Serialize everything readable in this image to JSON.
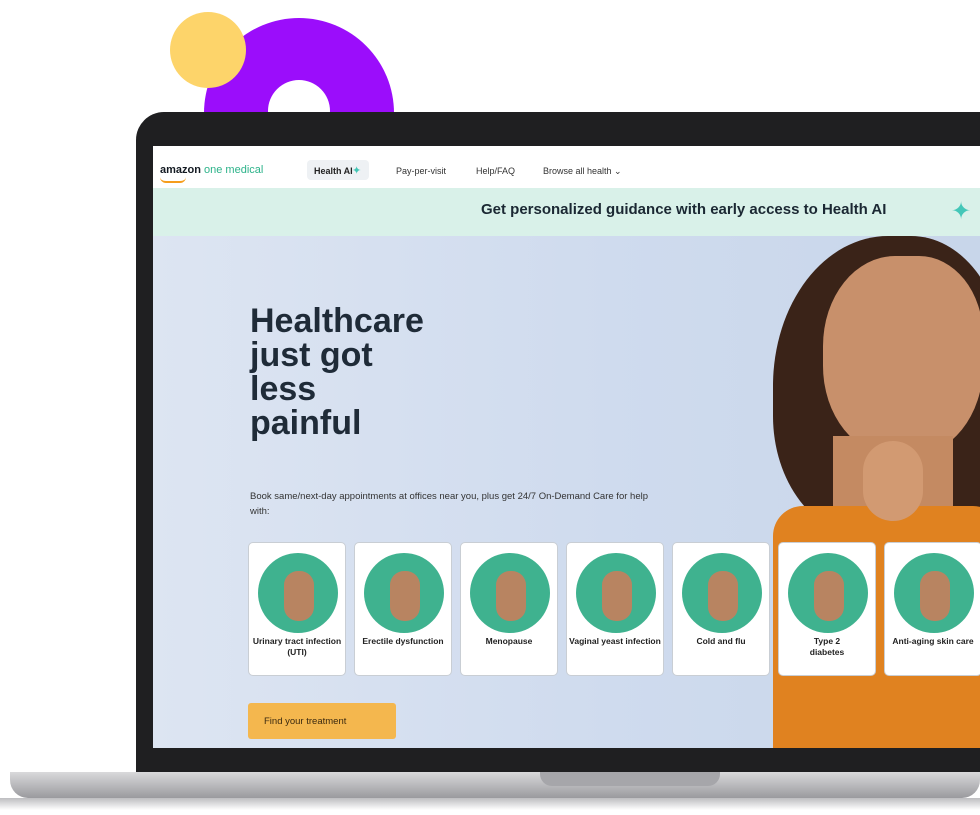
{
  "nav": {
    "logo_brand": "amazon",
    "logo_sub": " one medical",
    "items": [
      {
        "label": "Health AI"
      },
      {
        "label": "Pay-per-visit"
      },
      {
        "label": "Help/FAQ"
      },
      {
        "label": "Browse all health ⌄"
      }
    ]
  },
  "banner": {
    "text": "Get personalized guidance with early access to Health AI"
  },
  "hero": {
    "headline_lines": [
      "Healthcare",
      "just got",
      "less",
      "painful"
    ],
    "subcopy": "Book same/next-day appointments at offices near you, plus get 24/7 On-Demand Care for help with:",
    "cta": "Find your treatment"
  },
  "cards": [
    {
      "label": "Urinary tract infection (UTI)"
    },
    {
      "label": "Erectile dysfunction"
    },
    {
      "label": "Menopause"
    },
    {
      "label": "Vaginal yeast infection"
    },
    {
      "label": "Cold and flu"
    },
    {
      "label": "Type 2 diabetes"
    },
    {
      "label": "Anti-aging skin care"
    }
  ],
  "colors": {
    "purple": "#9b0dfb",
    "yellow": "#fdd46a",
    "banner_bg": "#d9f1e9",
    "card_circle": "#3fb28f",
    "cta_bg": "#f4b74e"
  },
  "icons": [
    "sparkle-icon",
    "chevron-down-icon"
  ]
}
